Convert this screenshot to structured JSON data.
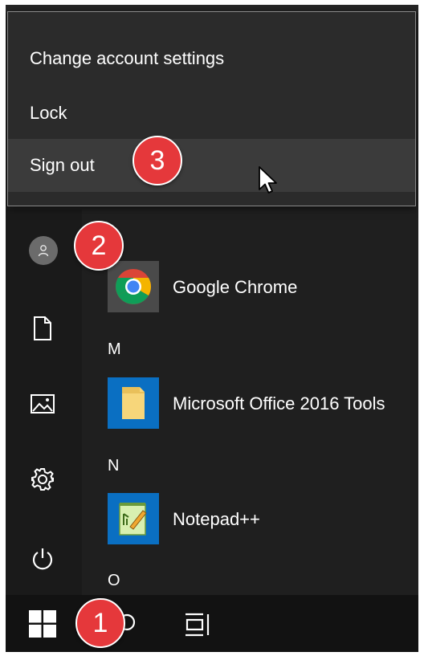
{
  "flyout": {
    "items": [
      {
        "label": "Change account settings"
      },
      {
        "label": "Lock"
      },
      {
        "label": "Sign out"
      }
    ]
  },
  "rail": {
    "icons": [
      "user-avatar-icon",
      "documents-icon",
      "pictures-icon",
      "settings-icon",
      "power-icon"
    ]
  },
  "apps": {
    "letter_m": "M",
    "letter_n": "N",
    "letter_o": "O",
    "items": [
      {
        "name": "Google Chrome",
        "icon": "chrome-icon"
      },
      {
        "name": "Microsoft Office 2016 Tools",
        "icon": "folder-icon"
      },
      {
        "name": "Notepad++",
        "icon": "notepad-plus-plus-icon"
      }
    ]
  },
  "taskbar": {
    "icons": [
      "windows-start-icon",
      "search-icon",
      "task-view-icon"
    ]
  },
  "badges": {
    "one": "1",
    "two": "2",
    "three": "3"
  },
  "colors": {
    "badge": "#e5383b",
    "tile_blue": "#0a6fc2",
    "flyout_bg": "#2b2b2b",
    "hover_bg": "#3b3b3b"
  }
}
